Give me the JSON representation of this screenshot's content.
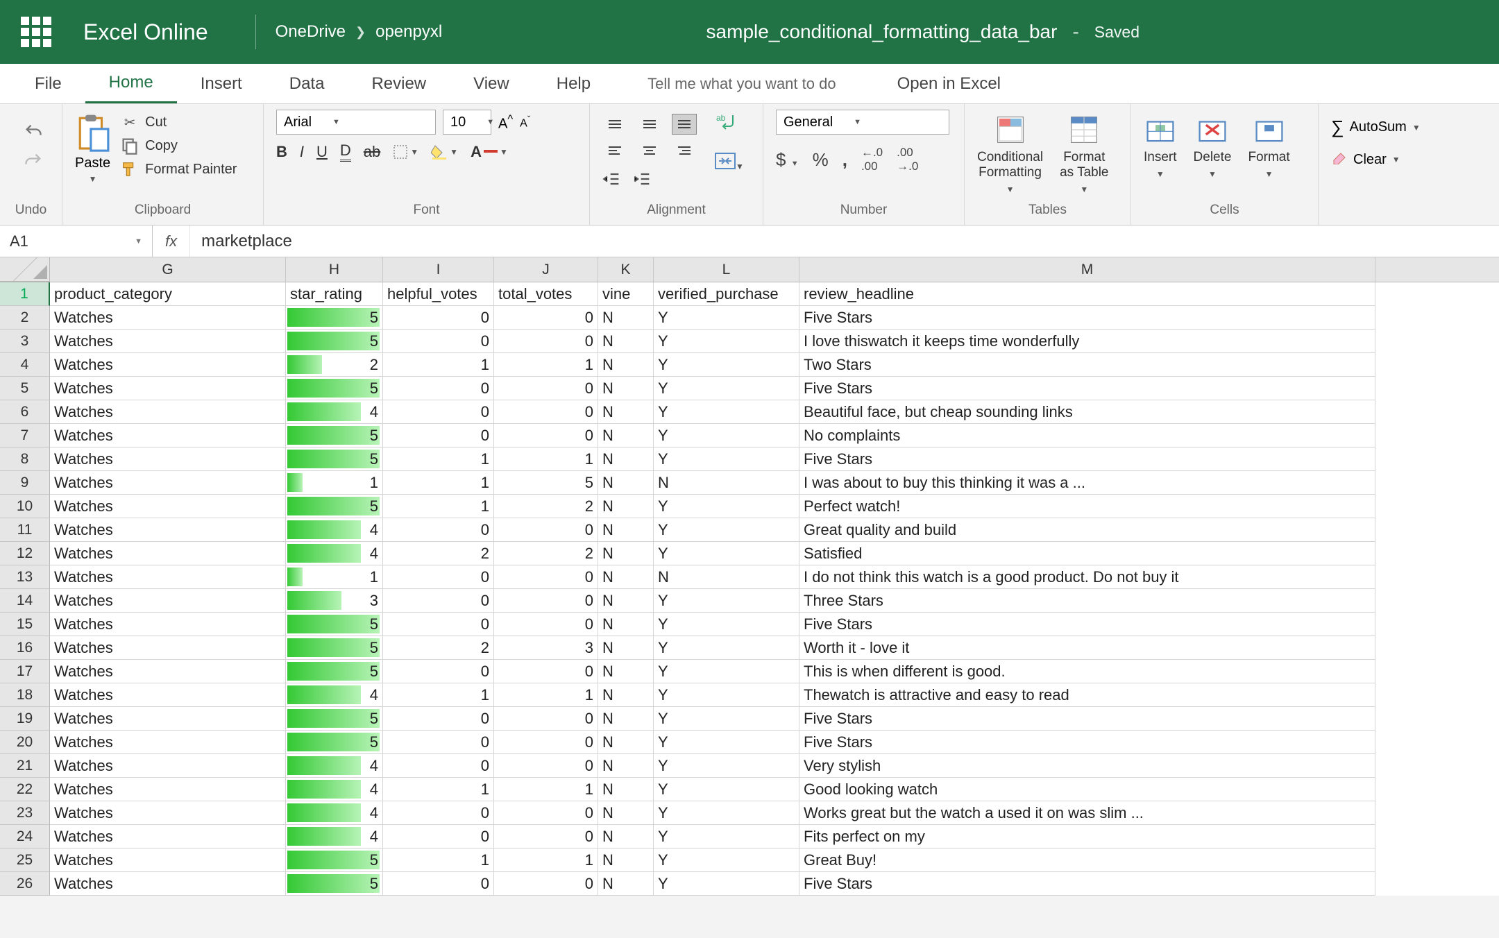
{
  "header": {
    "app_title": "Excel Online",
    "breadcrumb": [
      "OneDrive",
      "openpyxl"
    ],
    "doc_name": "sample_conditional_formatting_data_bar",
    "status": "Saved"
  },
  "tabs": {
    "items": [
      "File",
      "Home",
      "Insert",
      "Data",
      "Review",
      "View",
      "Help"
    ],
    "active": "Home",
    "tell_me": "Tell me what you want to do",
    "open_in": "Open in Excel"
  },
  "ribbon": {
    "undo": "Undo",
    "clipboard": {
      "label": "Clipboard",
      "paste": "Paste",
      "cut": "Cut",
      "copy": "Copy",
      "format_painter": "Format Painter"
    },
    "font": {
      "label": "Font",
      "name": "Arial",
      "size": "10"
    },
    "alignment": {
      "label": "Alignment"
    },
    "number": {
      "label": "Number",
      "format": "General"
    },
    "tables": {
      "label": "Tables",
      "conditional": "Conditional\nFormatting",
      "format_table": "Format\nas Table"
    },
    "cells": {
      "label": "Cells",
      "insert": "Insert",
      "delete": "Delete",
      "format": "Format"
    },
    "editing": {
      "autosum": "AutoSum",
      "clear": "Clear"
    }
  },
  "formula_bar": {
    "name_box": "A1",
    "formula": "marketplace"
  },
  "columns": [
    "G",
    "H",
    "I",
    "J",
    "K",
    "L",
    "M"
  ],
  "headers": [
    "product_category",
    "star_rating",
    "helpful_votes",
    "total_votes",
    "vine",
    "verified_purchase",
    "review_headline"
  ],
  "max_star": 5,
  "rows": [
    {
      "n": 1
    },
    {
      "n": 2,
      "G": "Watches",
      "H": 5,
      "I": 0,
      "J": 0,
      "K": "N",
      "L": "Y",
      "M": "Five Stars"
    },
    {
      "n": 3,
      "G": "Watches",
      "H": 5,
      "I": 0,
      "J": 0,
      "K": "N",
      "L": "Y",
      "M": "I love thiswatch it keeps time wonderfully"
    },
    {
      "n": 4,
      "G": "Watches",
      "H": 2,
      "I": 1,
      "J": 1,
      "K": "N",
      "L": "Y",
      "M": "Two Stars"
    },
    {
      "n": 5,
      "G": "Watches",
      "H": 5,
      "I": 0,
      "J": 0,
      "K": "N",
      "L": "Y",
      "M": "Five Stars"
    },
    {
      "n": 6,
      "G": "Watches",
      "H": 4,
      "I": 0,
      "J": 0,
      "K": "N",
      "L": "Y",
      "M": "Beautiful face, but cheap sounding links"
    },
    {
      "n": 7,
      "G": "Watches",
      "H": 5,
      "I": 0,
      "J": 0,
      "K": "N",
      "L": "Y",
      "M": "No complaints"
    },
    {
      "n": 8,
      "G": "Watches",
      "H": 5,
      "I": 1,
      "J": 1,
      "K": "N",
      "L": "Y",
      "M": "Five Stars"
    },
    {
      "n": 9,
      "G": "Watches",
      "H": 1,
      "I": 1,
      "J": 5,
      "K": "N",
      "L": "N",
      "M": "I was about to buy this thinking it was a ..."
    },
    {
      "n": 10,
      "G": "Watches",
      "H": 5,
      "I": 1,
      "J": 2,
      "K": "N",
      "L": "Y",
      "M": "Perfect watch!"
    },
    {
      "n": 11,
      "G": "Watches",
      "H": 4,
      "I": 0,
      "J": 0,
      "K": "N",
      "L": "Y",
      "M": "Great quality and build"
    },
    {
      "n": 12,
      "G": "Watches",
      "H": 4,
      "I": 2,
      "J": 2,
      "K": "N",
      "L": "Y",
      "M": "Satisfied"
    },
    {
      "n": 13,
      "G": "Watches",
      "H": 1,
      "I": 0,
      "J": 0,
      "K": "N",
      "L": "N",
      "M": "I do not think this watch is a good product. Do not buy it"
    },
    {
      "n": 14,
      "G": "Watches",
      "H": 3,
      "I": 0,
      "J": 0,
      "K": "N",
      "L": "Y",
      "M": "Three Stars"
    },
    {
      "n": 15,
      "G": "Watches",
      "H": 5,
      "I": 0,
      "J": 0,
      "K": "N",
      "L": "Y",
      "M": "Five Stars"
    },
    {
      "n": 16,
      "G": "Watches",
      "H": 5,
      "I": 2,
      "J": 3,
      "K": "N",
      "L": "Y",
      "M": "Worth it - love it"
    },
    {
      "n": 17,
      "G": "Watches",
      "H": 5,
      "I": 0,
      "J": 0,
      "K": "N",
      "L": "Y",
      "M": "This is when different is good."
    },
    {
      "n": 18,
      "G": "Watches",
      "H": 4,
      "I": 1,
      "J": 1,
      "K": "N",
      "L": "Y",
      "M": "Thewatch is attractive and easy to read"
    },
    {
      "n": 19,
      "G": "Watches",
      "H": 5,
      "I": 0,
      "J": 0,
      "K": "N",
      "L": "Y",
      "M": "Five Stars"
    },
    {
      "n": 20,
      "G": "Watches",
      "H": 5,
      "I": 0,
      "J": 0,
      "K": "N",
      "L": "Y",
      "M": "Five Stars"
    },
    {
      "n": 21,
      "G": "Watches",
      "H": 4,
      "I": 0,
      "J": 0,
      "K": "N",
      "L": "Y",
      "M": "Very stylish"
    },
    {
      "n": 22,
      "G": "Watches",
      "H": 4,
      "I": 1,
      "J": 1,
      "K": "N",
      "L": "Y",
      "M": "Good looking watch"
    },
    {
      "n": 23,
      "G": "Watches",
      "H": 4,
      "I": 0,
      "J": 0,
      "K": "N",
      "L": "Y",
      "M": "Works great but the watch a used it on was slim ..."
    },
    {
      "n": 24,
      "G": "Watches",
      "H": 4,
      "I": 0,
      "J": 0,
      "K": "N",
      "L": "Y",
      "M": "Fits perfect on my"
    },
    {
      "n": 25,
      "G": "Watches",
      "H": 5,
      "I": 1,
      "J": 1,
      "K": "N",
      "L": "Y",
      "M": "Great Buy!"
    },
    {
      "n": 26,
      "G": "Watches",
      "H": 5,
      "I": 0,
      "J": 0,
      "K": "N",
      "L": "Y",
      "M": "Five Stars"
    }
  ]
}
